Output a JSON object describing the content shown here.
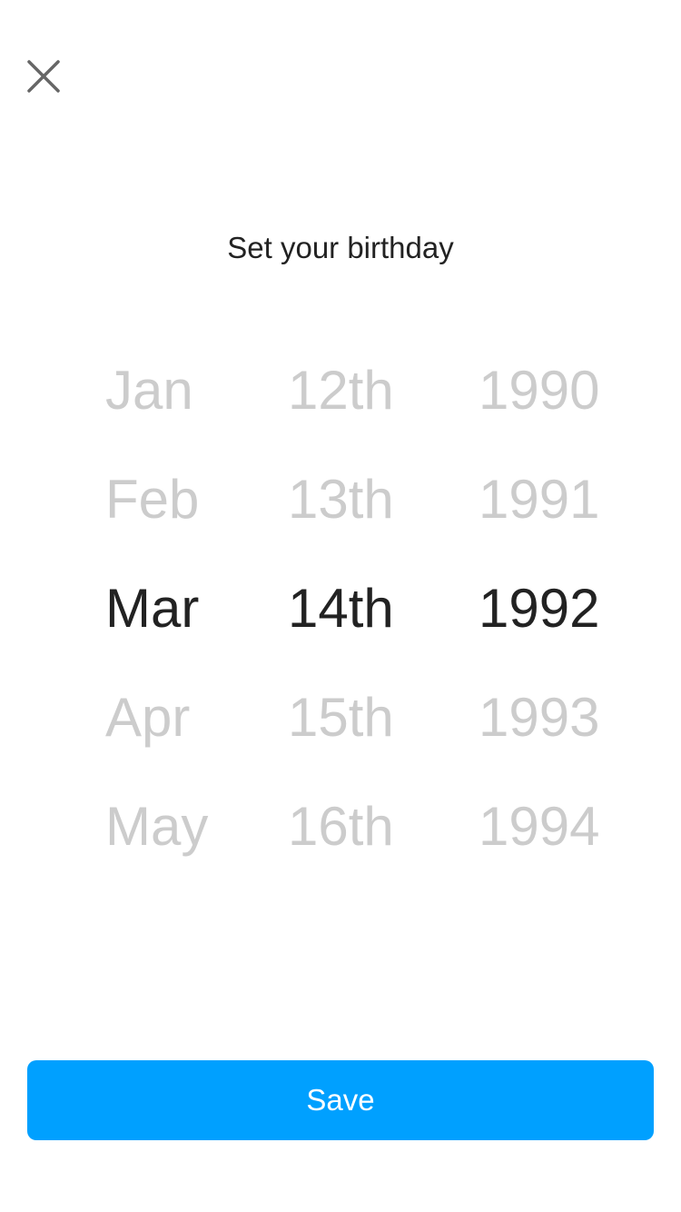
{
  "header": {
    "close_icon": "close-icon",
    "title": "Set your birthday"
  },
  "picker": {
    "months": [
      "Jan",
      "Feb",
      "Mar",
      "Apr",
      "May"
    ],
    "days": [
      "12th",
      "13th",
      "14th",
      "15th",
      "16th"
    ],
    "years": [
      "1990",
      "1991",
      "1992",
      "1993",
      "1994"
    ],
    "selected": {
      "month": "Mar",
      "day": "14th",
      "year": "1992"
    }
  },
  "footer": {
    "save_label": "Save",
    "accent_color": "#00a0ff"
  }
}
